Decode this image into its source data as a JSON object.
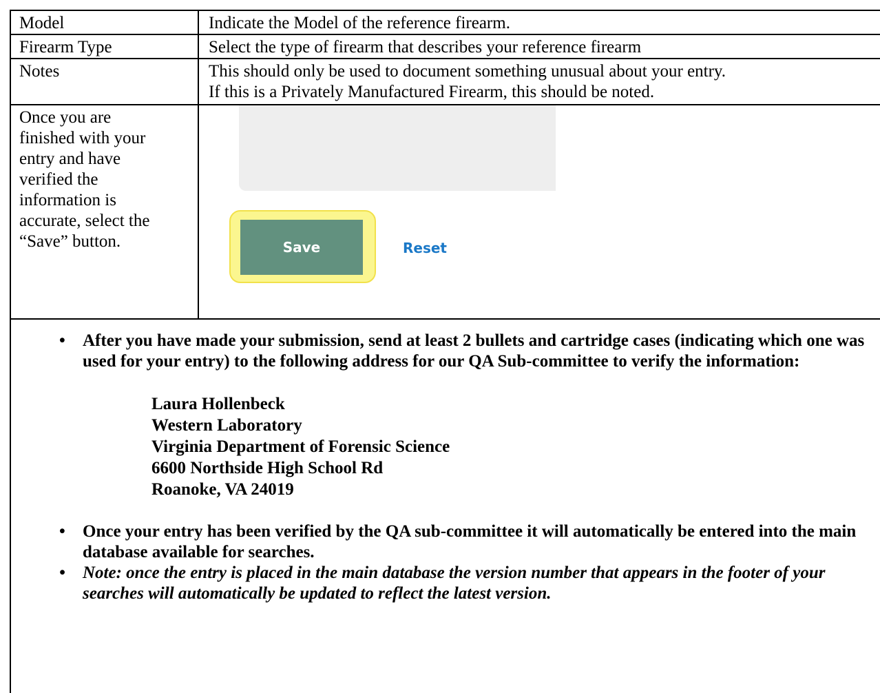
{
  "rows": [
    {
      "label": "Model",
      "description": "Indicate the Model of the reference firearm."
    },
    {
      "label": "Firearm Type",
      "description": "Select the type of firearm that  describes your reference firearm"
    },
    {
      "label": "Notes",
      "description_lines": [
        "This should only be used to document something unusual about your entry.",
        "If this is a Privately Manufactured Firearm, this should be noted."
      ]
    }
  ],
  "instruction_lines": [
    "Once you are",
    "finished with your",
    "entry and have",
    "verified the",
    "information is",
    "accurate, select the",
    "“Save” button."
  ],
  "screenshot": {
    "save_label": "Save",
    "reset_label": "Reset"
  },
  "bullets": {
    "submission": "After you have made your submission, send at least 2 bullets and cartridge cases (indicating which one was used for your entry) to the following address for our QA Sub-committee to verify the information:",
    "address": [
      "Laura Hollenbeck",
      "Western Laboratory",
      "Virginia Department of Forensic Science",
      "6600 Northside High School Rd",
      "Roanoke, VA 24019"
    ],
    "verified": "Once your entry has been verified by the QA sub-committee it will automatically be entered into the main database available for searches.",
    "note": "Note: once the entry is placed in the main database the version number that appears in the footer of your searches will automatically be updated to reflect the latest version."
  },
  "bullet_glyph": "•",
  "colors": {
    "save_button": "#62917f",
    "highlight": "#fbf68f",
    "reset_link": "#1a78c7"
  }
}
